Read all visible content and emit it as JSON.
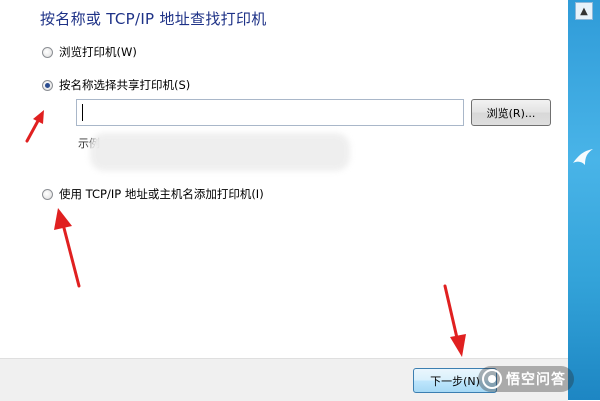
{
  "dialog": {
    "title": "按名称或 TCP/IP 地址查找打印机",
    "options": [
      {
        "label": "浏览打印机(W)",
        "checked": false
      },
      {
        "label": "按名称选择共享打印机(S)",
        "checked": true
      },
      {
        "label": "使用 TCP/IP 地址或主机名添加打印机(I)",
        "checked": false
      }
    ],
    "printer_name_input": {
      "value": "",
      "placeholder": ""
    },
    "browse_button_label": "浏览(R)...",
    "example_prefix": "示例",
    "next_button_label": "下一步(N)"
  },
  "watermark": {
    "text": "悟空问答"
  },
  "annotations": {
    "arrow_color": "#e02020"
  }
}
